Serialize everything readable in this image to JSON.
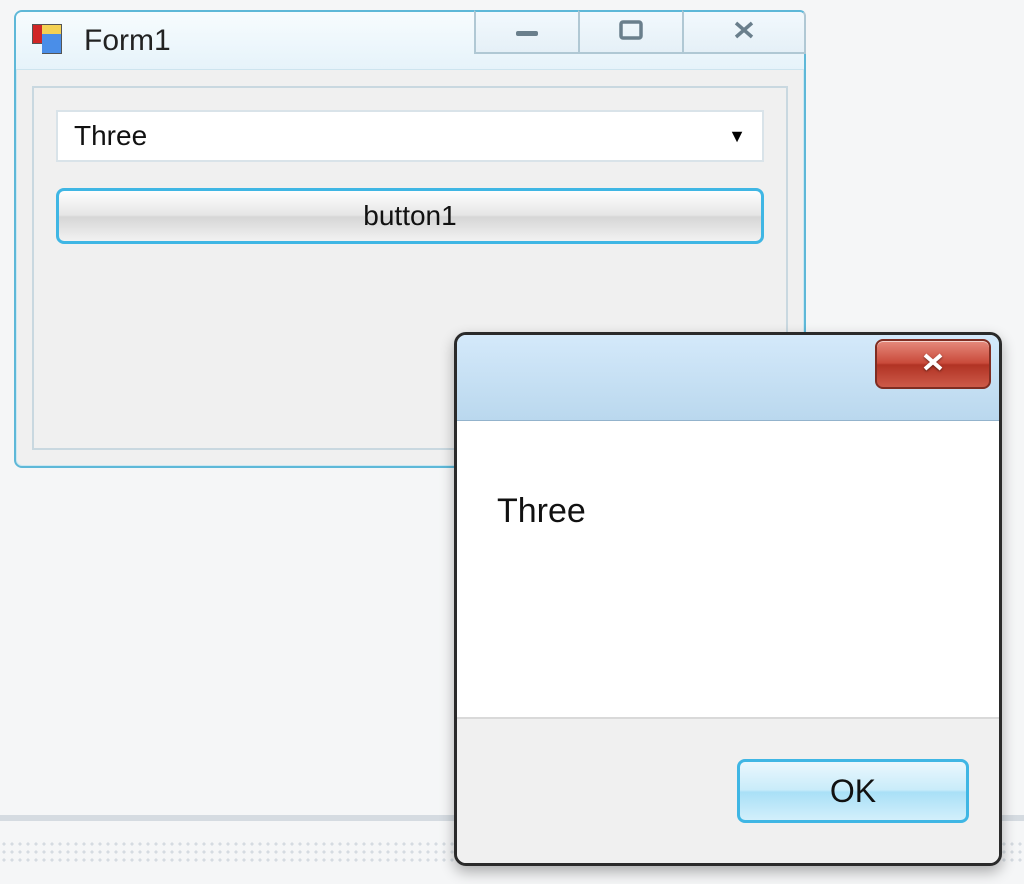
{
  "form1": {
    "title": "Form1",
    "combo_value": "Three",
    "button_label": "button1"
  },
  "msgbox": {
    "message": "Three",
    "ok_label": "OK"
  }
}
